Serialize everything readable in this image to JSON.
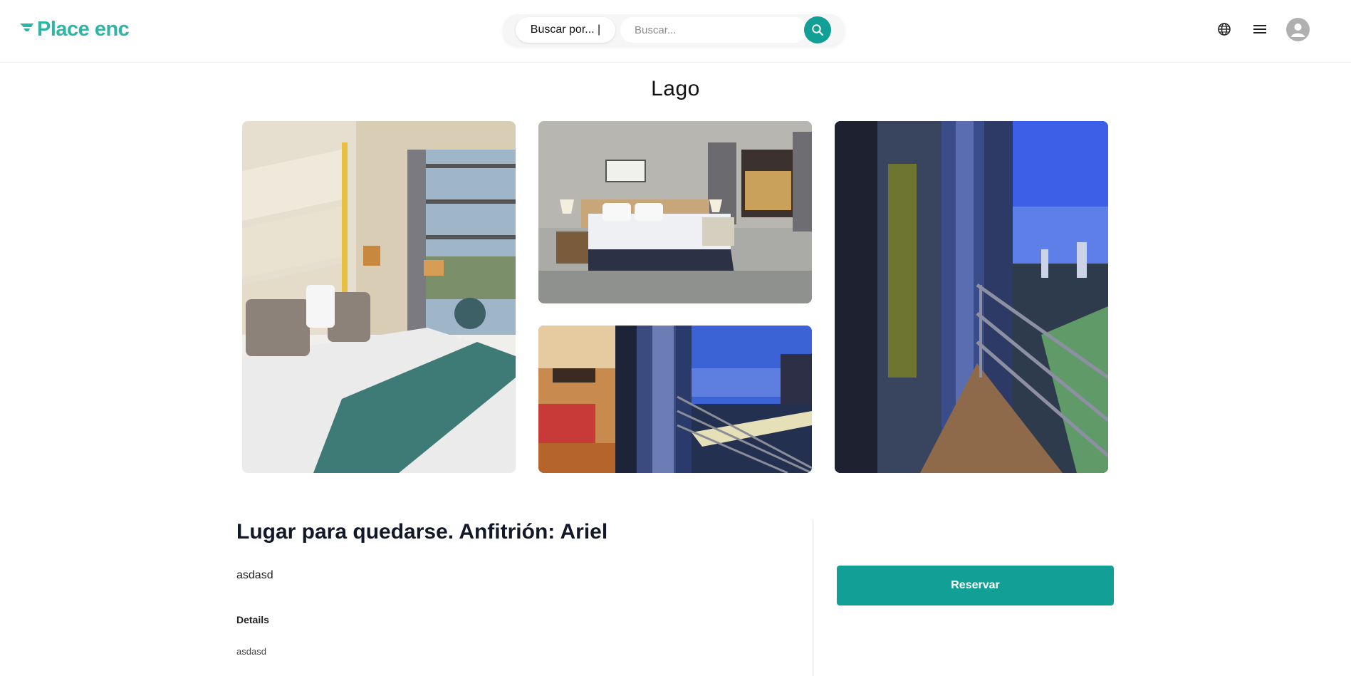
{
  "header": {
    "logo_text": "Place enc",
    "brand_color": "#2fb5a3",
    "search_by_label": "Buscar por... |",
    "search_placeholder": "Buscar...",
    "icons": [
      "search-icon",
      "globe-icon",
      "menu-icon",
      "user-avatar-icon"
    ]
  },
  "page": {
    "title": "Lago"
  },
  "gallery": {
    "photos": [
      "hotel-bedroom-teal-throw",
      "hotel-bedroom-city-view",
      "hotel-room-balcony-night",
      "balcony-city-skyline"
    ]
  },
  "listing": {
    "host_heading": "Lugar para quedarse. Anfitrión: Ariel",
    "description": "asdasd",
    "details_heading": "Details",
    "details_value": "asdasd"
  },
  "booking": {
    "reserve_label": "Reservar",
    "accent_color": "#129f96"
  }
}
